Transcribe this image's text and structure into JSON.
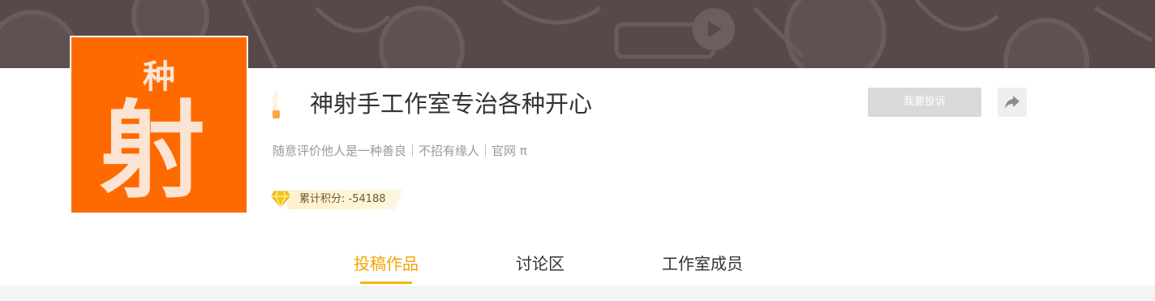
{
  "studio": {
    "name": "神射手工作室专治各种开心",
    "description": "随意评价他人是一种善良｜不招有缘人｜官网 π",
    "score_label": "累计积分: -54188",
    "avatar_glyph_top": "种",
    "avatar_glyph_main": "射"
  },
  "actions": {
    "report_label": "我要投诉",
    "share_icon": "share-arrow-icon"
  },
  "tabs": [
    {
      "label": "投稿作品",
      "active": true
    },
    {
      "label": "讨论区",
      "active": false
    },
    {
      "label": "工作室成员",
      "active": false
    }
  ],
  "colors": {
    "banner": "#57494a",
    "avatar_bg": "#ff6a00",
    "accent": "#f0a500",
    "report_btn": "#d9d9d9",
    "score_ribbon": "#fdf1cf"
  }
}
